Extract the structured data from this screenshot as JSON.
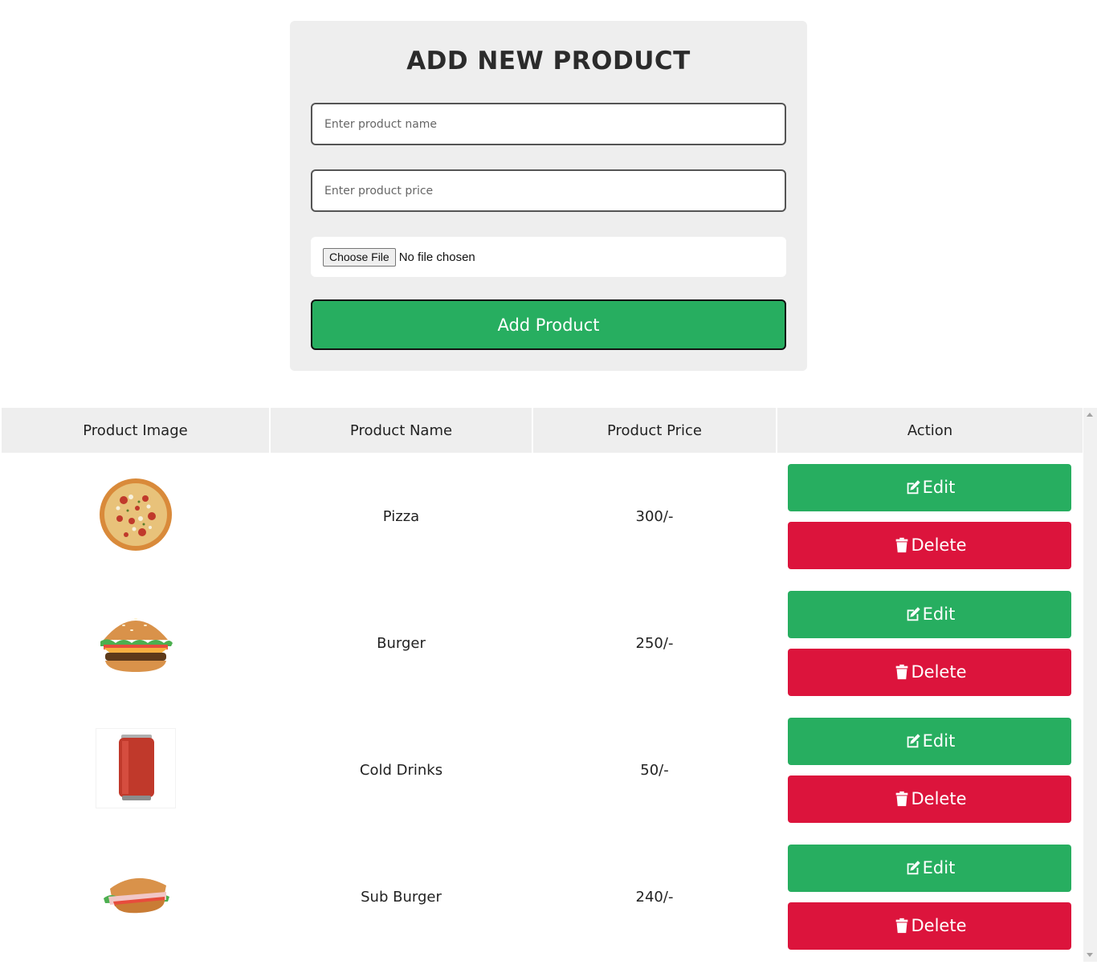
{
  "form": {
    "title": "ADD NEW PRODUCT",
    "name_placeholder": "Enter product name",
    "price_placeholder": "Enter product price",
    "file_button_label": "Choose File",
    "file_status": "No file chosen",
    "submit_label": "Add Product"
  },
  "table": {
    "headers": [
      "Product Image",
      "Product Name",
      "Product Price",
      "Action"
    ],
    "rows": [
      {
        "image": "pizza-image",
        "name": "Pizza",
        "price": "300/-",
        "edit_label": "Edit",
        "delete_label": "Delete"
      },
      {
        "image": "burger-image",
        "name": "Burger",
        "price": "250/-",
        "edit_label": "Edit",
        "delete_label": "Delete"
      },
      {
        "image": "cola-can-image",
        "name": "Cold Drinks",
        "price": "50/-",
        "edit_label": "Edit",
        "delete_label": "Delete"
      },
      {
        "image": "sub-burger-image",
        "name": "Sub Burger",
        "price": "240/-",
        "edit_label": "Edit",
        "delete_label": "Delete"
      }
    ]
  },
  "icons": {
    "edit": "edit-icon",
    "delete": "trash-icon"
  },
  "colors": {
    "edit": "#27ae60",
    "delete": "#dc143c",
    "add": "#27ae60"
  }
}
